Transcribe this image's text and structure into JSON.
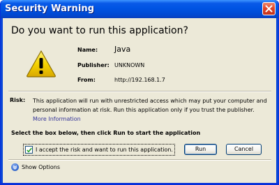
{
  "window": {
    "title": "Security Warning"
  },
  "dialog": {
    "question": "Do you want to run this application?",
    "fields": {
      "name_label": "Name:",
      "name_value": "Java",
      "publisher_label": "Publisher:",
      "publisher_value": "UNKNOWN",
      "from_label": "From:",
      "from_value": "http://192.168.1.7"
    },
    "risk": {
      "label": "Risk:",
      "text": "This application will run with unrestricted access which may put your computer and personal information at risk. Run this application only if you trust the publisher.",
      "more_info": "More Information"
    },
    "instruction": "Select the box below, then click Run to start the application",
    "accept_checkbox": {
      "label": "I accept the risk and want to run this application.",
      "checked": true
    },
    "buttons": {
      "run": "Run",
      "cancel": "Cancel"
    },
    "show_options": "Show Options"
  },
  "colors": {
    "titlebar": "#0054e3",
    "dialog_bg": "#ece9d8",
    "link": "#333399",
    "warning_yellow": "#f5d300"
  },
  "icons": [
    "close-icon",
    "warning-icon",
    "check-icon",
    "chevron-down-icon"
  ]
}
